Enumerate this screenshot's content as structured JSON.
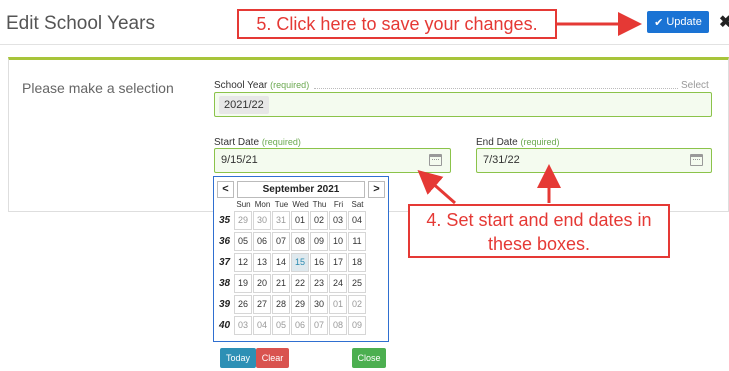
{
  "header": {
    "title": "Edit School Years",
    "update_label": "Update",
    "close_glyph": "✖"
  },
  "form": {
    "prompt": "Please make a selection",
    "school_year": {
      "label": "School Year",
      "required": "(required)",
      "select_text": "Select",
      "value": "2021/22"
    },
    "start_date": {
      "label": "Start Date",
      "required": "(required)",
      "value": "9/15/21"
    },
    "end_date": {
      "label": "End Date",
      "required": "(required)",
      "value": "7/31/22"
    }
  },
  "datepicker": {
    "prev": "<",
    "next": ">",
    "month": "September 2021",
    "dow": [
      "Sun",
      "Mon",
      "Tue",
      "Wed",
      "Thu",
      "Fri",
      "Sat"
    ],
    "weeks": [
      {
        "wk": "35",
        "days": [
          "29",
          "30",
          "31",
          "01",
          "02",
          "03",
          "04"
        ]
      },
      {
        "wk": "36",
        "days": [
          "05",
          "06",
          "07",
          "08",
          "09",
          "10",
          "11"
        ]
      },
      {
        "wk": "37",
        "days": [
          "12",
          "13",
          "14",
          "15",
          "16",
          "17",
          "18"
        ]
      },
      {
        "wk": "38",
        "days": [
          "19",
          "20",
          "21",
          "22",
          "23",
          "24",
          "25"
        ]
      },
      {
        "wk": "39",
        "days": [
          "26",
          "27",
          "28",
          "29",
          "30",
          "01",
          "02"
        ]
      },
      {
        "wk": "40",
        "days": [
          "03",
          "04",
          "05",
          "06",
          "07",
          "08",
          "09"
        ]
      }
    ],
    "today": "Today",
    "clear": "Clear",
    "close": "Close"
  },
  "annotations": {
    "step5": "5. Click here to save your changes.",
    "step4_line1": "4. Set start and end dates in",
    "step4_line2": "these boxes."
  },
  "colors": {
    "accent": "#1a73d4",
    "field_border": "#8bc34a",
    "callout": "#e53935"
  }
}
